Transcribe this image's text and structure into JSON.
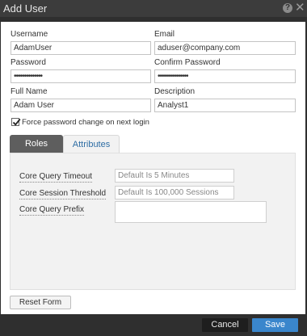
{
  "window": {
    "title": "Add User",
    "help_icon": "question-circle-icon",
    "help_glyph": "?",
    "close_icon": "close-icon",
    "close_glyph": "✕"
  },
  "form": {
    "username": {
      "label": "Username",
      "value": "AdamUser"
    },
    "email": {
      "label": "Email",
      "value": "aduser@company.com"
    },
    "password": {
      "label": "Password",
      "value": "••••••••••••••"
    },
    "confirm_password": {
      "label": "Confirm Password",
      "value": "•••••••••••••••"
    },
    "full_name": {
      "label": "Full Name",
      "value": "Adam User"
    },
    "description": {
      "label": "Description",
      "value": "Analyst1"
    },
    "force_change": {
      "label": "Force password change on next login",
      "checked": true
    }
  },
  "tabs": [
    {
      "label": "Roles",
      "active": false
    },
    {
      "label": "Attributes",
      "active": true
    }
  ],
  "attributes": {
    "core_query_timeout": {
      "label": "Core Query Timeout",
      "placeholder": "Default Is 5 Minutes"
    },
    "core_session_threshold": {
      "label": "Core Session Threshold",
      "placeholder": "Default Is 100,000 Sessions"
    },
    "core_query_prefix": {
      "label": "Core Query Prefix",
      "value": ""
    }
  },
  "buttons": {
    "reset": "Reset Form",
    "cancel": "Cancel",
    "save": "Save"
  },
  "colors": {
    "title_bar": "#3c3c3c",
    "dialog_bg": "#2f2f2f",
    "active_tab_text": "#2e6da4",
    "inactive_tab_bg": "#5e5e5e",
    "save_button": "#3a86cc",
    "cancel_button": "#1e1e1e"
  }
}
